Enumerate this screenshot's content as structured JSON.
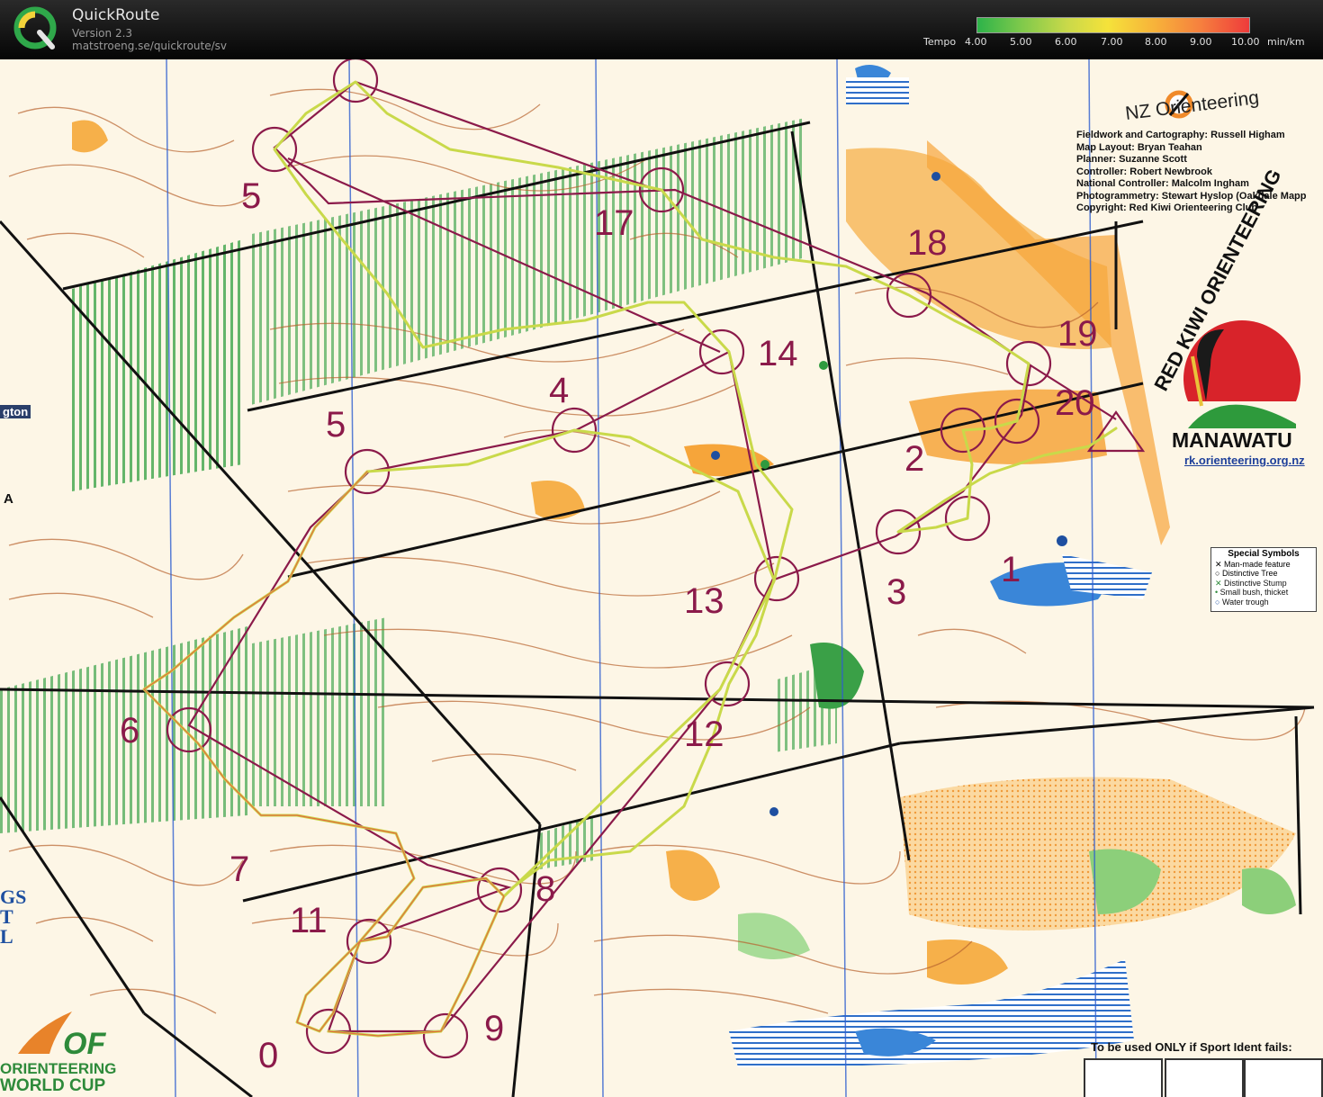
{
  "app": {
    "title": "QuickRoute",
    "version": "Version 2.3",
    "url": "matstroeng.se/quickroute/sv"
  },
  "pace_scale": {
    "label": "Tempo",
    "ticks": [
      "4.00",
      "5.00",
      "6.00",
      "7.00",
      "8.00",
      "9.00",
      "10.00"
    ],
    "unit": "min/km",
    "colors": [
      "#2db34a",
      "#7ec94b",
      "#c9d94a",
      "#f5e23a",
      "#f7b33a",
      "#f6803e",
      "#ee3b3b"
    ]
  },
  "map": {
    "credits": [
      "Fieldwork and Cartography: Russell Higham",
      "Map Layout: Bryan Teahan",
      "Planner: Suzanne Scott",
      "Controller: Robert Newbrook",
      "National Controller: Malcolm Ingham",
      "Photogrammetry: Stewart Hyslop (Oakdale Mapp",
      "Copyright: Red Kiwi Orienteering Club"
    ],
    "nz_logo": "NZ Orienteering",
    "club_arc": "RED KIWI ORIENTEERING",
    "club_name": "MANAWATU",
    "club_link": "rk.orienteering.org.nz",
    "special_symbols": {
      "title": "Special Symbols",
      "items": [
        "Man-made feature",
        "Distinctive Tree",
        "Distinctive Stump",
        "Small bush, thicket",
        "Water trough"
      ]
    },
    "sport_ident": "To be used ONLY if Sport Ident fails:",
    "world_cup": [
      "ORIENTEERING",
      "WORLD CUP"
    ],
    "edge_fragments": [
      "gton",
      "A",
      "GS",
      "T",
      "L"
    ],
    "controls": [
      "0",
      "1",
      "2",
      "3",
      "4",
      "5",
      "5",
      "6",
      "7",
      "8",
      "9",
      "11",
      "12",
      "13",
      "14",
      "17",
      "18",
      "19",
      "20"
    ],
    "colors": {
      "paper": "#fdf6e6",
      "contour": "#b8642f",
      "course": "#8b1a4a",
      "vegetation": "#2f9a3f",
      "open": "#f6a53a",
      "water": "#2f6fc9",
      "road": "#1a1a1a"
    }
  }
}
